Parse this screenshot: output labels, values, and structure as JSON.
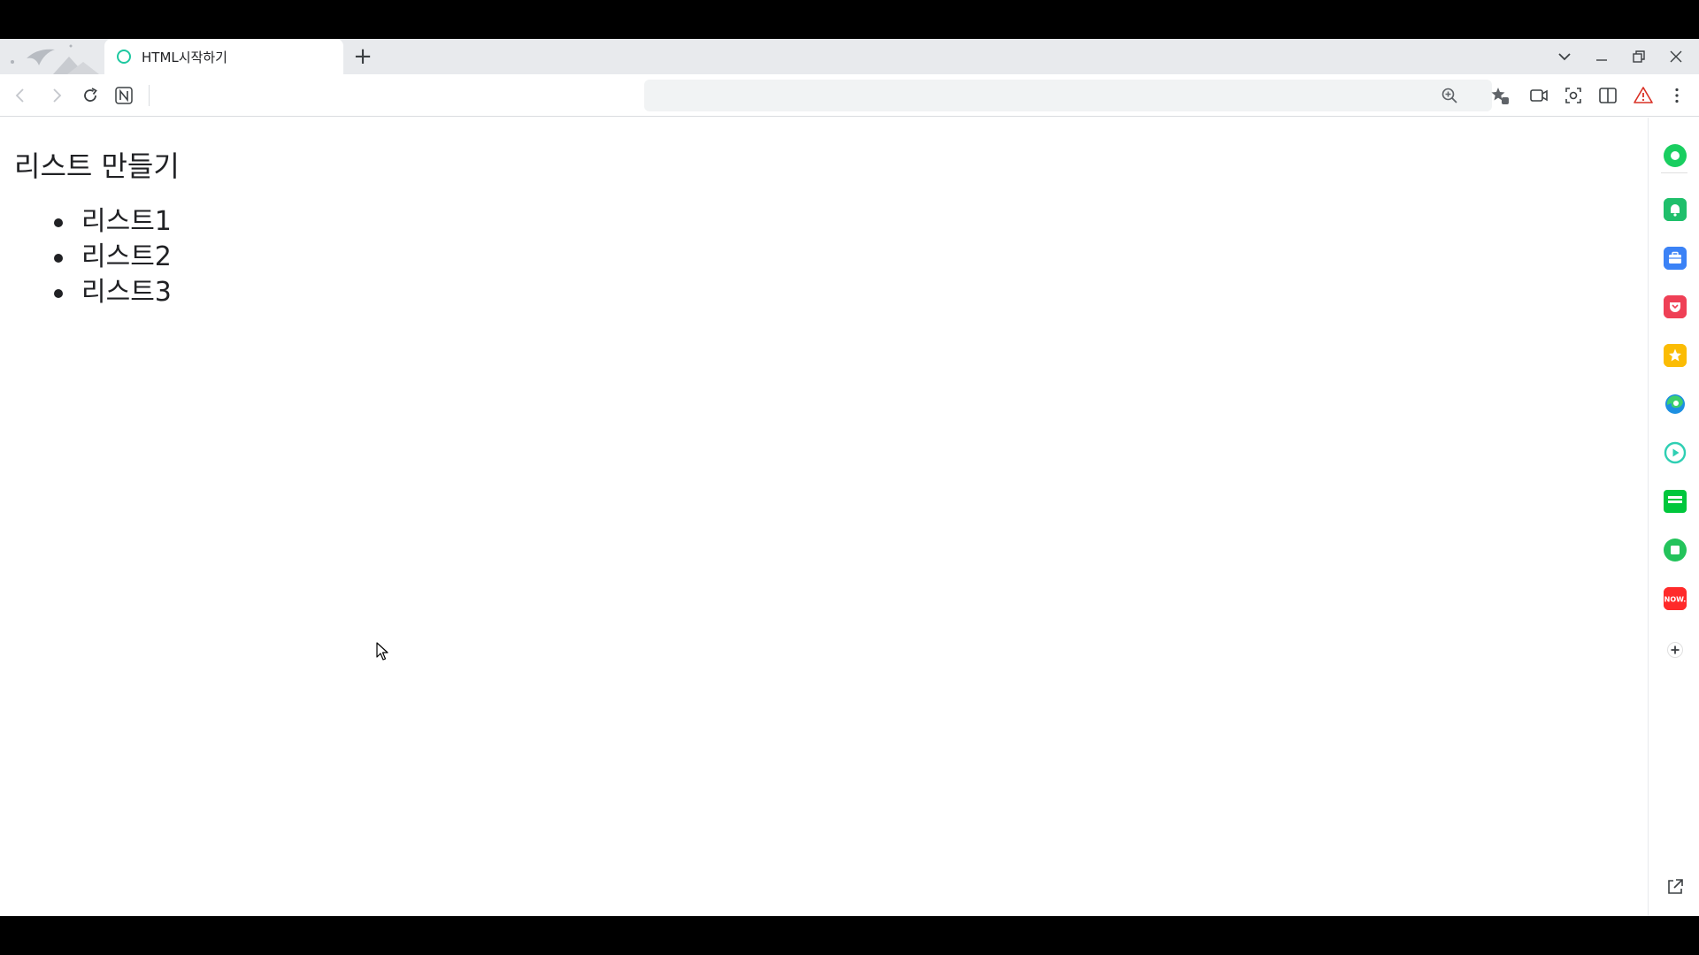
{
  "tab": {
    "title": "HTML시작하기"
  },
  "toolbar": {
    "omnibox_value": "",
    "omnibox_placeholder": ""
  },
  "page": {
    "heading": "리스트 만들기",
    "list_items": [
      "리스트1",
      "리스트2",
      "리스트3"
    ]
  },
  "sidebar": {
    "items": [
      {
        "name": "naver-green-circle",
        "color": "#19ce60"
      },
      {
        "name": "green-bell",
        "color": "#1fbf6b"
      },
      {
        "name": "blue-briefcase",
        "color": "#3b82f6"
      },
      {
        "name": "red-pocket",
        "color": "#ef4056"
      },
      {
        "name": "yellow-star",
        "color": "#fbbc04"
      },
      {
        "name": "edge-browser",
        "color": "#1d8fe1"
      },
      {
        "name": "teal-play",
        "color": "#2ecfb3"
      },
      {
        "name": "green-webtoon",
        "color": "#00c73c"
      },
      {
        "name": "green-square",
        "color": "#23c35b"
      },
      {
        "name": "red-now",
        "color": "#ff2a2a"
      }
    ],
    "now_label": "NOW."
  },
  "colors": {
    "accent_teal": "#1ec8a0",
    "chrome_gray": "#e8eaed",
    "warning_red": "#d93025"
  }
}
